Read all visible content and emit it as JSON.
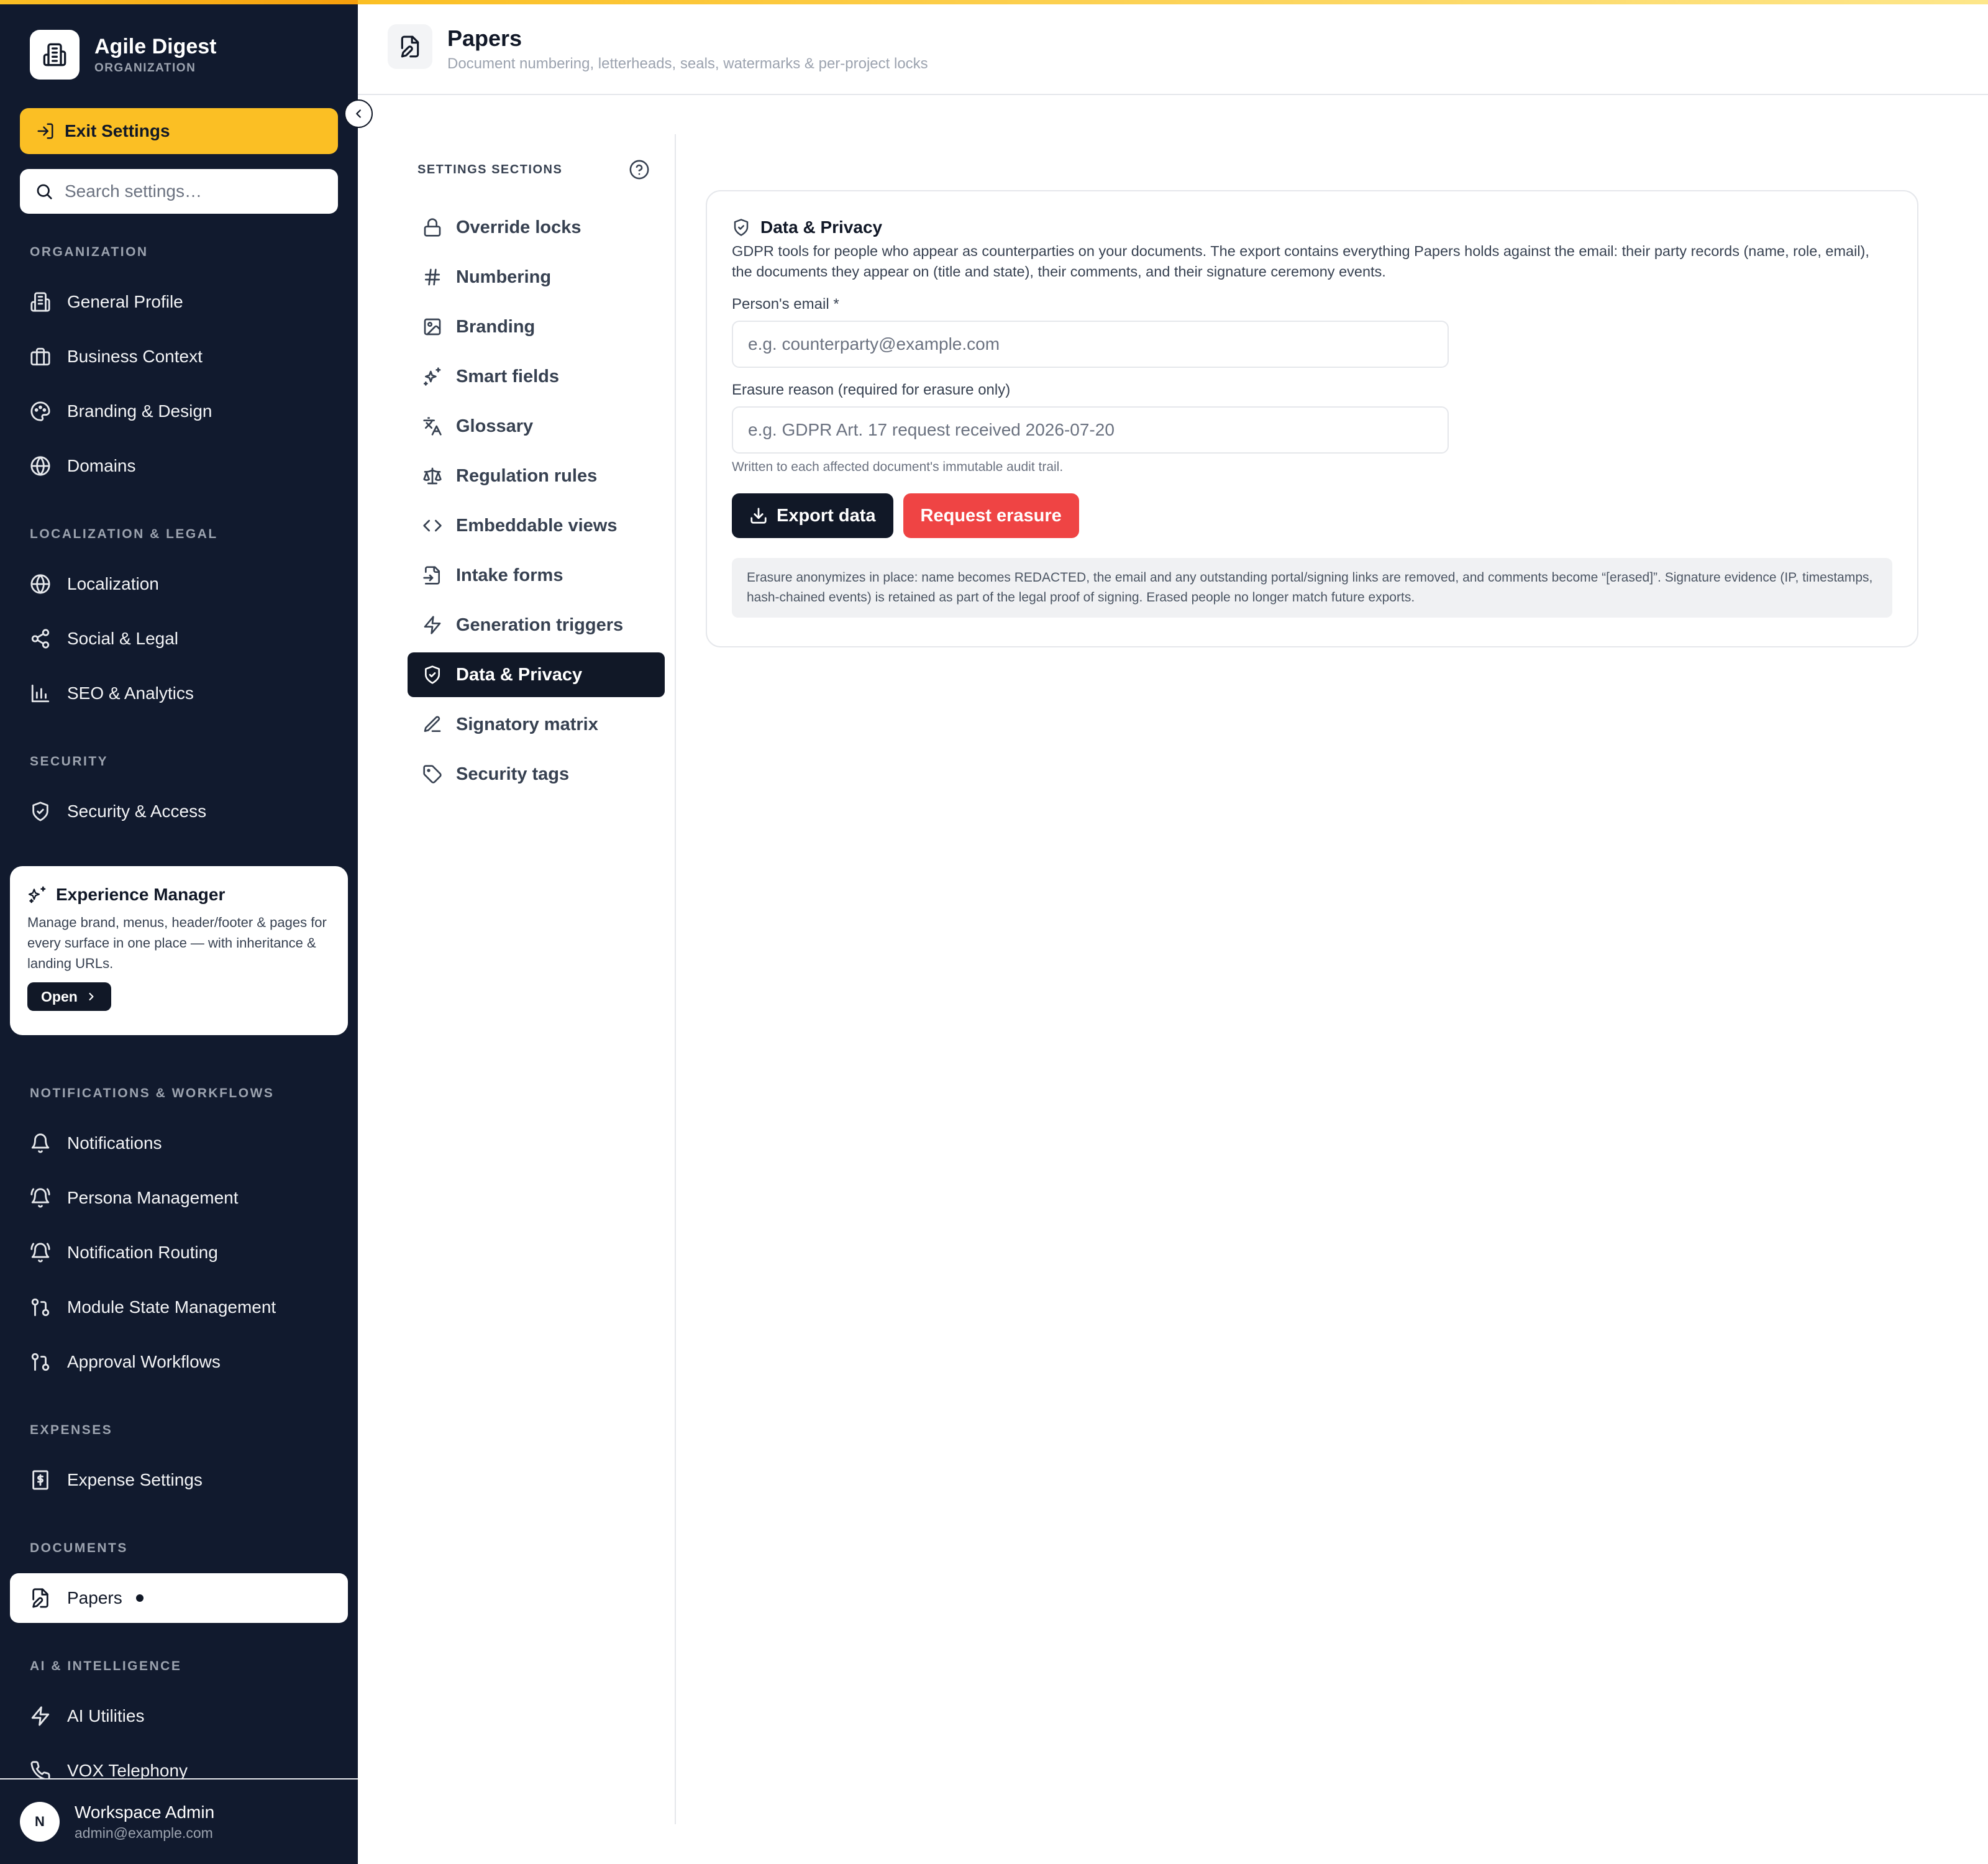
{
  "org": {
    "name": "Agile Digest",
    "subtitle": "ORGANIZATION"
  },
  "sidebar": {
    "exit_label": "Exit Settings",
    "search_placeholder": "Search settings…",
    "sections": [
      {
        "label": "ORGANIZATION",
        "items": [
          "General Profile",
          "Business Context",
          "Branding & Design",
          "Domains"
        ]
      },
      {
        "label": "LOCALIZATION & LEGAL",
        "items": [
          "Localization",
          "Social & Legal",
          "SEO & Analytics"
        ]
      },
      {
        "label": "SECURITY",
        "items": [
          "Security & Access"
        ]
      },
      {
        "label": "NOTIFICATIONS & WORKFLOWS",
        "items": [
          "Notifications",
          "Persona Management",
          "Notification Routing",
          "Module State Management",
          "Approval Workflows"
        ]
      },
      {
        "label": "EXPENSES",
        "items": [
          "Expense Settings"
        ]
      },
      {
        "label": "DOCUMENTS",
        "items": [
          "Papers"
        ]
      },
      {
        "label": "AI & INTELLIGENCE",
        "items": [
          "AI Utilities",
          "VOX Telephony"
        ]
      }
    ],
    "experience_manager": {
      "title": "Experience Manager",
      "description": "Manage brand, menus, header/footer & pages for every surface in one place — with inheritance & landing URLs.",
      "open_label": "Open"
    },
    "user": {
      "initial": "N",
      "name": "Workspace Admin",
      "email": "admin@example.com"
    }
  },
  "header": {
    "title": "Papers",
    "subtitle": "Document numbering, letterheads, seals, watermarks & per-project locks"
  },
  "settings_sections": {
    "heading": "SETTINGS SECTIONS",
    "items": [
      {
        "label": "Override locks",
        "icon": "lock-icon"
      },
      {
        "label": "Numbering",
        "icon": "hash-icon"
      },
      {
        "label": "Branding",
        "icon": "image-icon"
      },
      {
        "label": "Smart fields",
        "icon": "sparkles-icon"
      },
      {
        "label": "Glossary",
        "icon": "languages-icon"
      },
      {
        "label": "Regulation rules",
        "icon": "scale-icon"
      },
      {
        "label": "Embeddable views",
        "icon": "code-icon"
      },
      {
        "label": "Intake forms",
        "icon": "file-input-icon"
      },
      {
        "label": "Generation triggers",
        "icon": "zap-icon"
      },
      {
        "label": "Data & Privacy",
        "icon": "shield-icon",
        "active": true
      },
      {
        "label": "Signatory matrix",
        "icon": "pen-icon"
      },
      {
        "label": "Security tags",
        "icon": "tag-icon"
      }
    ]
  },
  "privacy": {
    "title": "Data & Privacy",
    "description": "GDPR tools for people who appear as counterparties on your documents. The export contains everything Papers holds against the email: their party records (name, role, email), the documents they appear on (title and state), their comments, and their signature ceremony events.",
    "email_label": "Person's email *",
    "email_placeholder": "e.g. counterparty@example.com",
    "reason_label": "Erasure reason (required for erasure only)",
    "reason_placeholder": "e.g. GDPR Art. 17 request received 2026-07-20",
    "reason_hint": "Written to each affected document's immutable audit trail.",
    "export_label": "Export data",
    "erasure_label": "Request erasure",
    "notice": "Erasure anonymizes in place: name becomes REDACTED, the email and any outstanding portal/signing links are removed, and comments become “[erased]”. Signature evidence (IP, timestamps, hash-chained events) is retained as part of the legal proof of signing. Erased people no longer match future exports."
  },
  "colors": {
    "sidebar_bg": "#111a2e",
    "accent": "#fbbf24",
    "danger": "#ef4444",
    "primary": "#111827"
  }
}
